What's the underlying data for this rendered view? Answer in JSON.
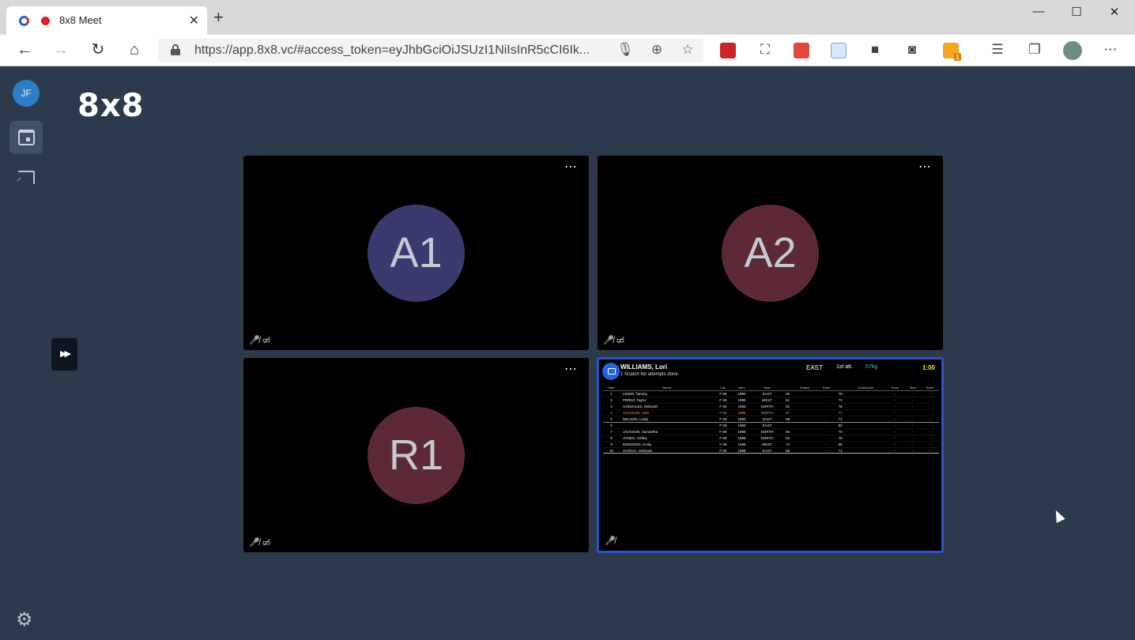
{
  "browser": {
    "tab_title": "8x8 Meet",
    "url": "https://app.8x8.vc/#access_token=eyJhbGciOiJSUzI1NiIsInR5cCI6Ik...",
    "ext_badge_count": "1"
  },
  "app": {
    "logo": "8x8",
    "user_initials": "JF",
    "collapse_glyph": "▶▶"
  },
  "tiles": [
    {
      "initials": "A1",
      "color": "#3b3a6e",
      "muted_mic": true,
      "muted_cam": true
    },
    {
      "initials": "A2",
      "color": "#5e2937",
      "muted_mic": true,
      "muted_cam": true
    },
    {
      "initials": "R1",
      "color": "#5e2937",
      "muted_mic": true,
      "muted_cam": true
    }
  ],
  "scoreboard": {
    "athlete": "WILLIAMS, Lori",
    "subtitle": "1 Snatch    No attempts done.",
    "team": "EAST",
    "attempt": "1st att.",
    "weight": "57kg",
    "clock": "1:00",
    "headers": [
      "Start",
      "Name",
      "Cat.",
      "Born",
      "Team",
      "",
      "Snatch",
      "",
      "Rank",
      "",
      "Clean&Jerk",
      "",
      "Rank",
      "Total",
      "Rank"
    ],
    "rows": [
      [
        "1",
        "LEWIS, Tammy",
        "F 59",
        "1992",
        "EAST",
        "82",
        "",
        "",
        "-",
        "79",
        "",
        "",
        "-",
        "-",
        "-"
      ],
      [
        "2",
        "PEREZ, Taylor",
        "F 59",
        "1996",
        "WEST",
        "81",
        "",
        "",
        "-",
        "73",
        "",
        "",
        "-",
        "-",
        "-"
      ],
      [
        "3",
        "GONZALEZ, Deborah",
        "F 60",
        "1993",
        "NORTH",
        "81",
        "",
        "",
        "-",
        "78",
        "",
        "",
        "-",
        "-",
        "-"
      ],
      [
        "4",
        "JACKSON, Julie",
        "F 60",
        "1998",
        "NORTH",
        "57",
        "",
        "",
        "-",
        "77",
        "",
        "",
        "-",
        "-",
        "-"
      ],
      [
        "5",
        "NELSON, Linda",
        "F 59",
        "1993",
        "EAST",
        "59",
        "",
        "",
        "-",
        "71",
        "",
        "",
        "-",
        "-",
        "-"
      ],
      [
        "6",
        "",
        "F 59",
        "1992",
        "EAST",
        "",
        "",
        "",
        "-",
        "82",
        "",
        "",
        "-",
        "-",
        "-"
      ],
      [
        "7",
        "JACKSON, Samantha",
        "F 59",
        "1996",
        "NORTH",
        "84",
        "",
        "",
        "-",
        "70",
        "",
        "",
        "-",
        "-",
        "-"
      ],
      [
        "8",
        "JONES, Ashley",
        "F 59",
        "1998",
        "NORTH",
        "82",
        "",
        "",
        "-",
        "78",
        "",
        "",
        "-",
        "-",
        "-"
      ],
      [
        "9",
        "EDWARDS, Emily",
        "F 59",
        "1996",
        "WEST",
        "74",
        "",
        "",
        "-",
        "86",
        "",
        "",
        "-",
        "-",
        "-"
      ],
      [
        "10",
        "GARCIA, Deborah",
        "F 60",
        "1998",
        "EAST",
        "56",
        "",
        "",
        "-",
        "71",
        "",
        "",
        "-",
        "-",
        "-"
      ]
    ]
  }
}
